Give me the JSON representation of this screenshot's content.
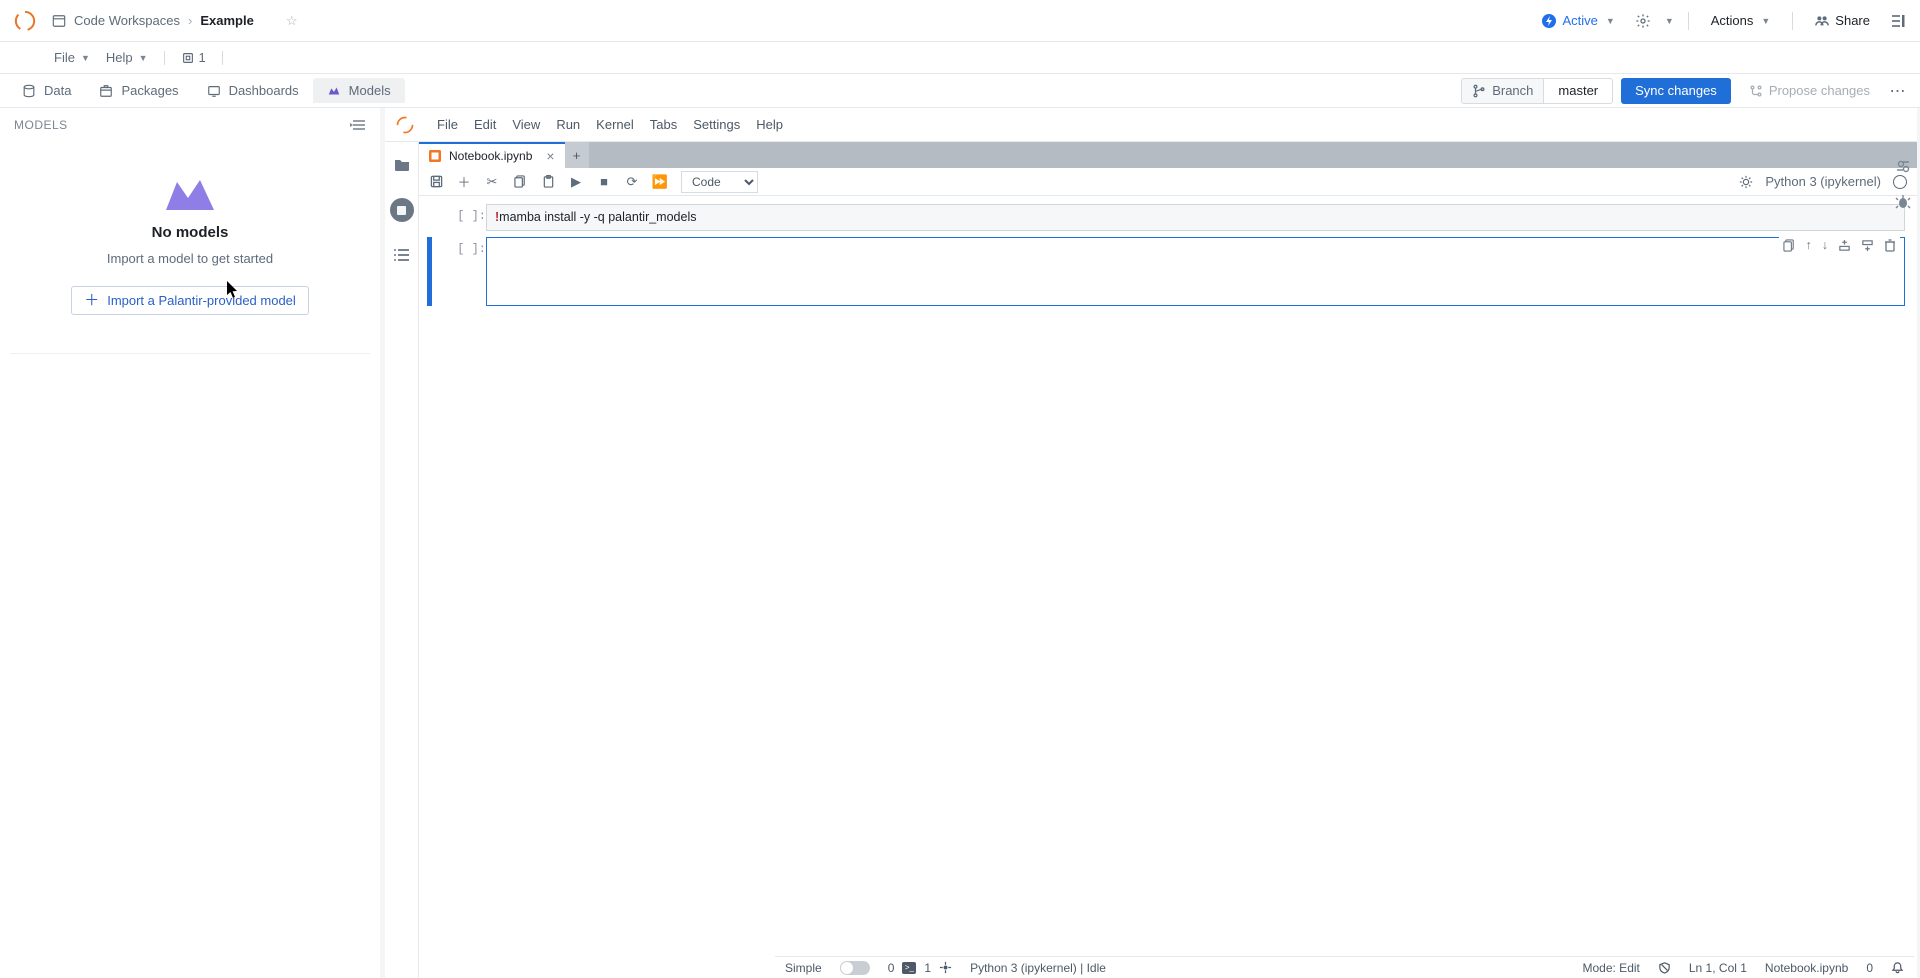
{
  "header": {
    "breadcrumb_root": "Code Workspaces",
    "breadcrumb_current": "Example",
    "status_label": "Active",
    "actions_label": "Actions",
    "share_label": "Share"
  },
  "submenu": {
    "file": "File",
    "help": "Help",
    "count": "1"
  },
  "tabs": {
    "data": "Data",
    "packages": "Packages",
    "dashboards": "Dashboards",
    "models": "Models",
    "branch_label": "Branch",
    "branch_value": "master",
    "sync": "Sync changes",
    "propose": "Propose changes"
  },
  "left": {
    "section": "MODELS",
    "empty_title": "No models",
    "empty_sub": "Import a model to get started",
    "import_btn": "Import a Palantir-provided model"
  },
  "jupyter": {
    "menus": [
      "File",
      "Edit",
      "View",
      "Run",
      "Kernel",
      "Tabs",
      "Settings",
      "Help"
    ],
    "tab_name": "Notebook.ipynb",
    "cell_type": "Code",
    "kernel": "Python 3 (ipykernel)",
    "cells": [
      {
        "prompt": "[ ]:",
        "code_prefix": "!",
        "code_body": "mamba install -y -q palantir_models"
      },
      {
        "prompt": "[ ]:",
        "code_prefix": "",
        "code_body": ""
      }
    ]
  },
  "status": {
    "simple": "Simple",
    "zero": "0",
    "one": "1",
    "kernel": "Python 3 (ipykernel) | Idle",
    "mode": "Mode: Edit",
    "lncol": "Ln 1, Col 1",
    "file": "Notebook.ipynb",
    "zero2": "0"
  }
}
